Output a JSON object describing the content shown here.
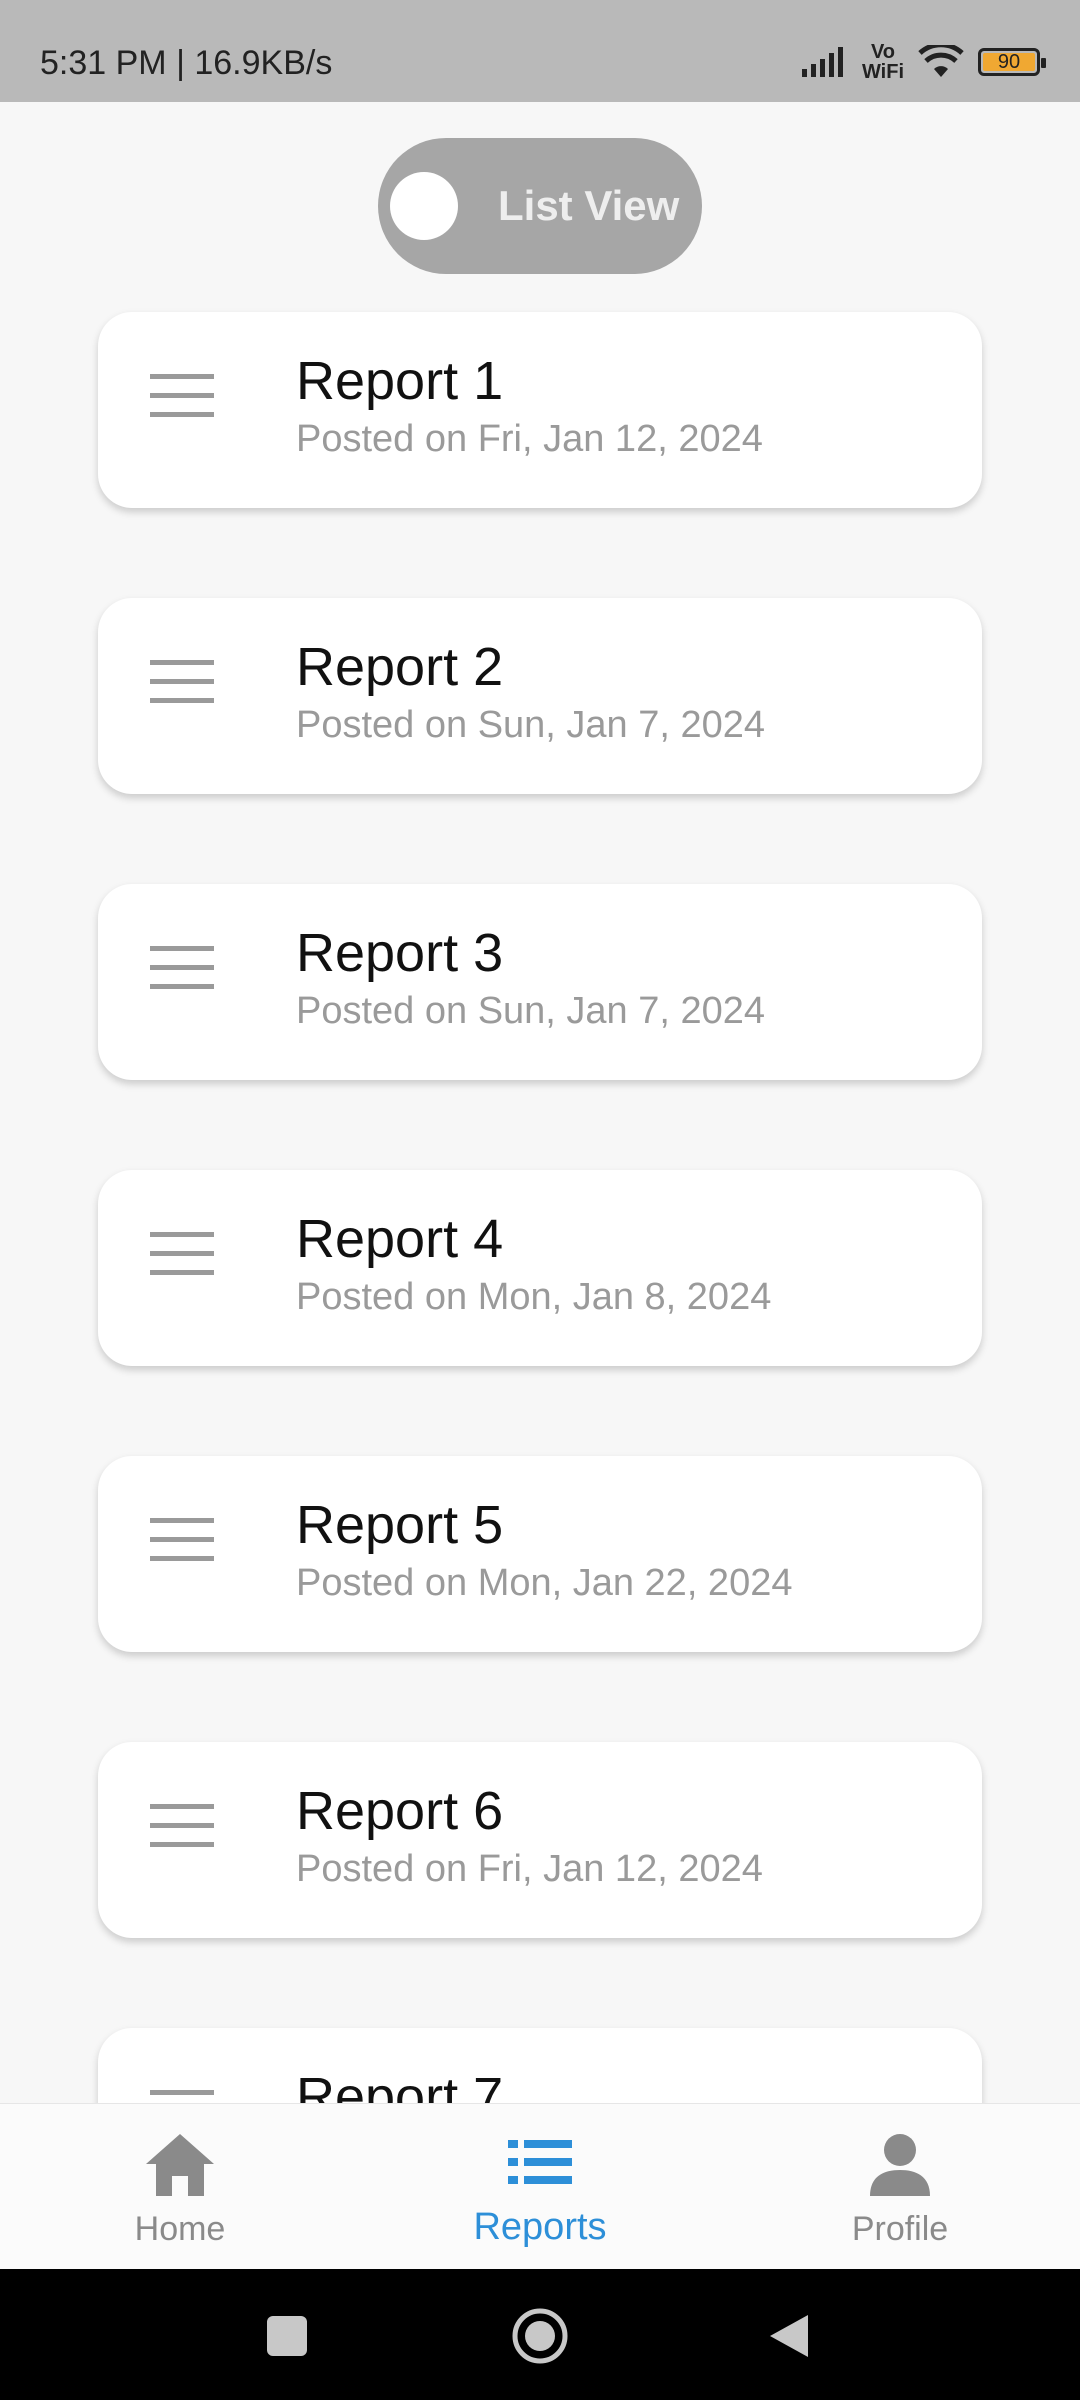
{
  "status_bar": {
    "time_speed": "5:31 PM | 16.9KB/s",
    "vo_label": "Vo",
    "wifi_label": "WiFi",
    "battery": "90",
    "battery_color": "#f0a832"
  },
  "view_toggle": {
    "label": "List View"
  },
  "reports": [
    {
      "title": "Report 1",
      "subtitle": "Posted on Fri, Jan 12, 2024"
    },
    {
      "title": "Report 2",
      "subtitle": "Posted on Sun, Jan 7, 2024"
    },
    {
      "title": "Report 3",
      "subtitle": "Posted on Sun, Jan 7, 2024"
    },
    {
      "title": "Report 4",
      "subtitle": "Posted on Mon, Jan 8, 2024"
    },
    {
      "title": "Report 5",
      "subtitle": "Posted on Mon, Jan 22, 2024"
    },
    {
      "title": "Report 6",
      "subtitle": "Posted on Fri, Jan 12, 2024"
    },
    {
      "title": "Report 7",
      "subtitle": ""
    }
  ],
  "bottom_nav": {
    "items": [
      {
        "label": "Home",
        "icon": "home-icon"
      },
      {
        "label": "Reports",
        "icon": "list-icon",
        "active": true
      },
      {
        "label": "Profile",
        "icon": "person-icon"
      }
    ],
    "active_color": "#2d8fd8"
  },
  "system_nav": {
    "icons": [
      "recents-icon",
      "home-circle-icon",
      "back-icon"
    ]
  }
}
